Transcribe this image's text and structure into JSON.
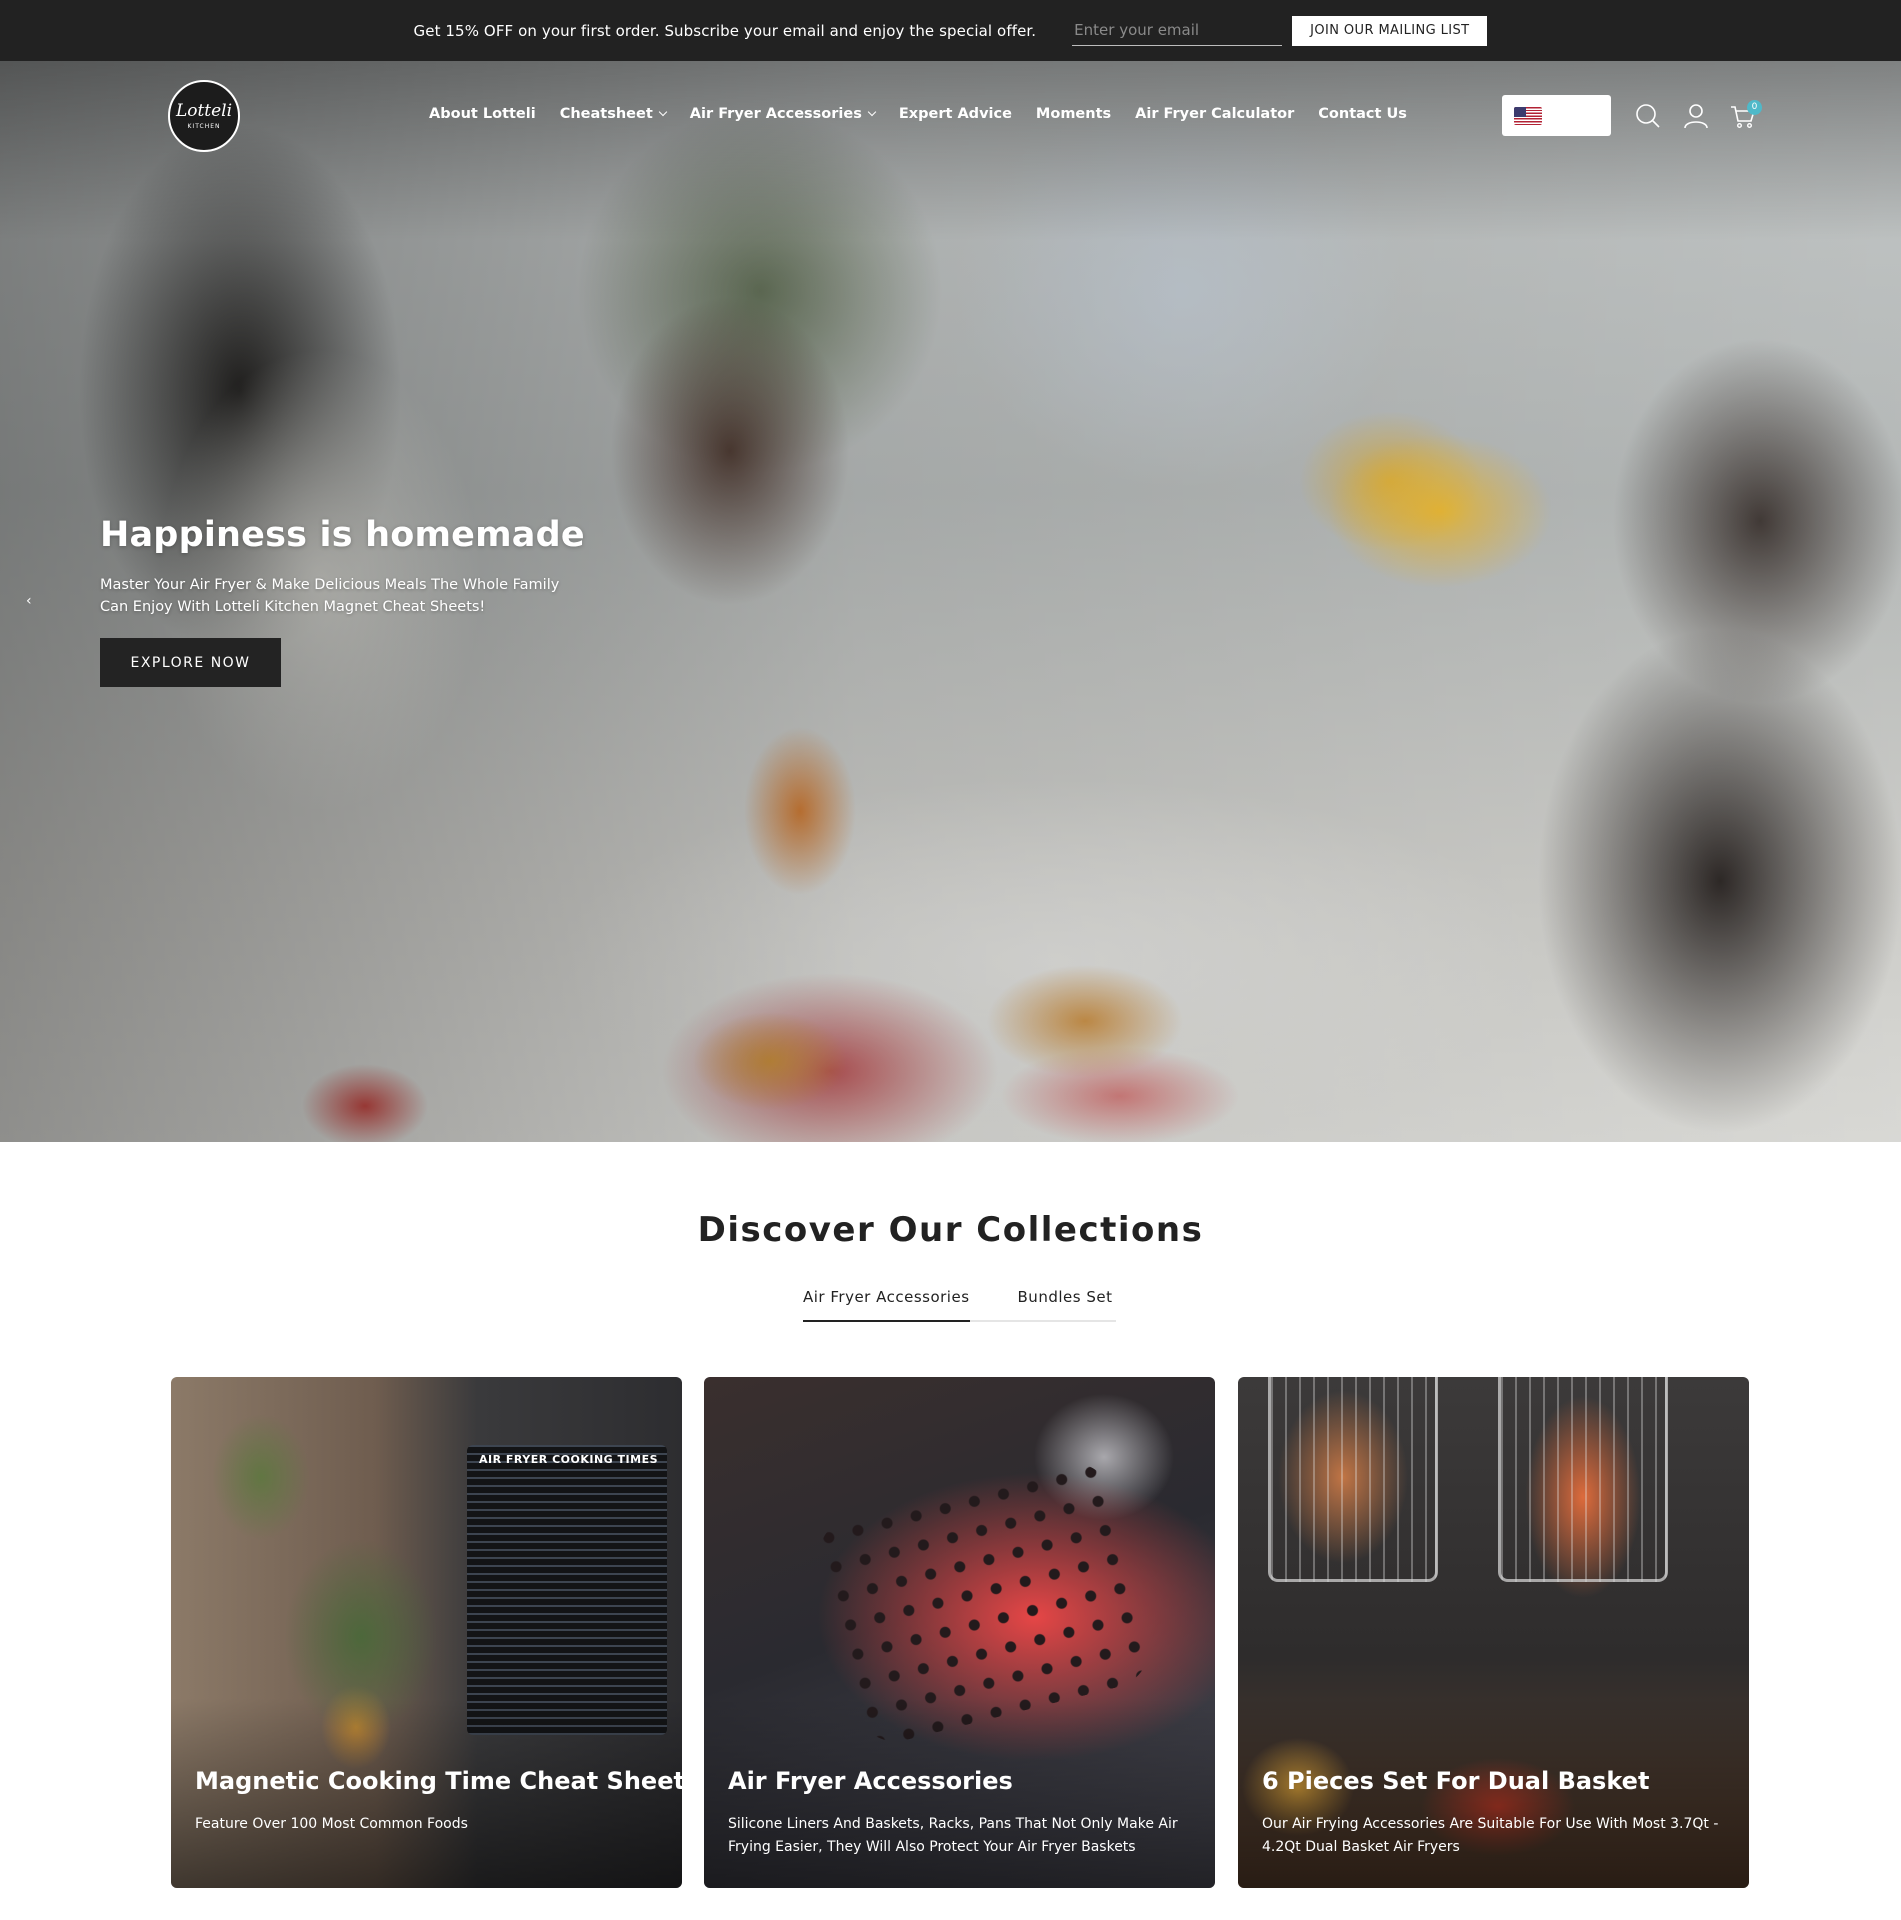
{
  "announcement": {
    "promo_text": "Get 15% OFF on your first order. Subscribe your email and enjoy the special offer.",
    "email_placeholder": "Enter your email",
    "join_label": "JOIN OUR MAILING LIST"
  },
  "header": {
    "logo_text": "Lotteli",
    "logo_subtext": "KITCHEN",
    "nav": [
      {
        "label": "About Lotteli",
        "has_dropdown": false
      },
      {
        "label": "Cheatsheet",
        "has_dropdown": true
      },
      {
        "label": "Air Fryer Accessories",
        "has_dropdown": true
      },
      {
        "label": "Expert Advice",
        "has_dropdown": false
      },
      {
        "label": "Moments",
        "has_dropdown": false
      },
      {
        "label": "Air Fryer Calculator",
        "has_dropdown": false
      },
      {
        "label": "Contact Us",
        "has_dropdown": false
      }
    ],
    "currency_flag": "us-flag-icon",
    "icons": [
      "search-icon",
      "user-icon",
      "cart-icon"
    ],
    "cart_count": "0"
  },
  "hero": {
    "title": "Happiness is homemade",
    "subtitle": "Master Your Air Fryer & Make Delicious Meals The Whole Family Can Enjoy With Lotteli Kitchen Magnet Cheat Sheets!",
    "cta_label": "EXPLORE NOW",
    "prev_arrow": "‹"
  },
  "collections": {
    "title": "Discover Our Collections",
    "tabs": [
      {
        "label": "Air Fryer Accessories",
        "active": true
      },
      {
        "label": "Bundles Set",
        "active": false
      }
    ],
    "cards": [
      {
        "title": "Magnetic Cooking Time Cheat Sheets",
        "description": "Feature Over 100 Most Common Foods",
        "image_text": "AIR FRYER COOKING TIMES"
      },
      {
        "title": "Air Fryer Accessories",
        "description": "Silicone Liners And Baskets, Racks, Pans That Not Only Make Air Frying Easier, They Will Also Protect Your Air Fryer Baskets"
      },
      {
        "title": "6 Pieces Set For Dual Basket",
        "description": "Our Air Frying Accessories Are Suitable For Use With Most 3.7Qt - 4.2Qt Dual Basket Air Fryers"
      }
    ]
  },
  "colors": {
    "topbar_bg": "#222222",
    "cart_badge": "#4fb9c9",
    "button_dark": "#232323"
  }
}
